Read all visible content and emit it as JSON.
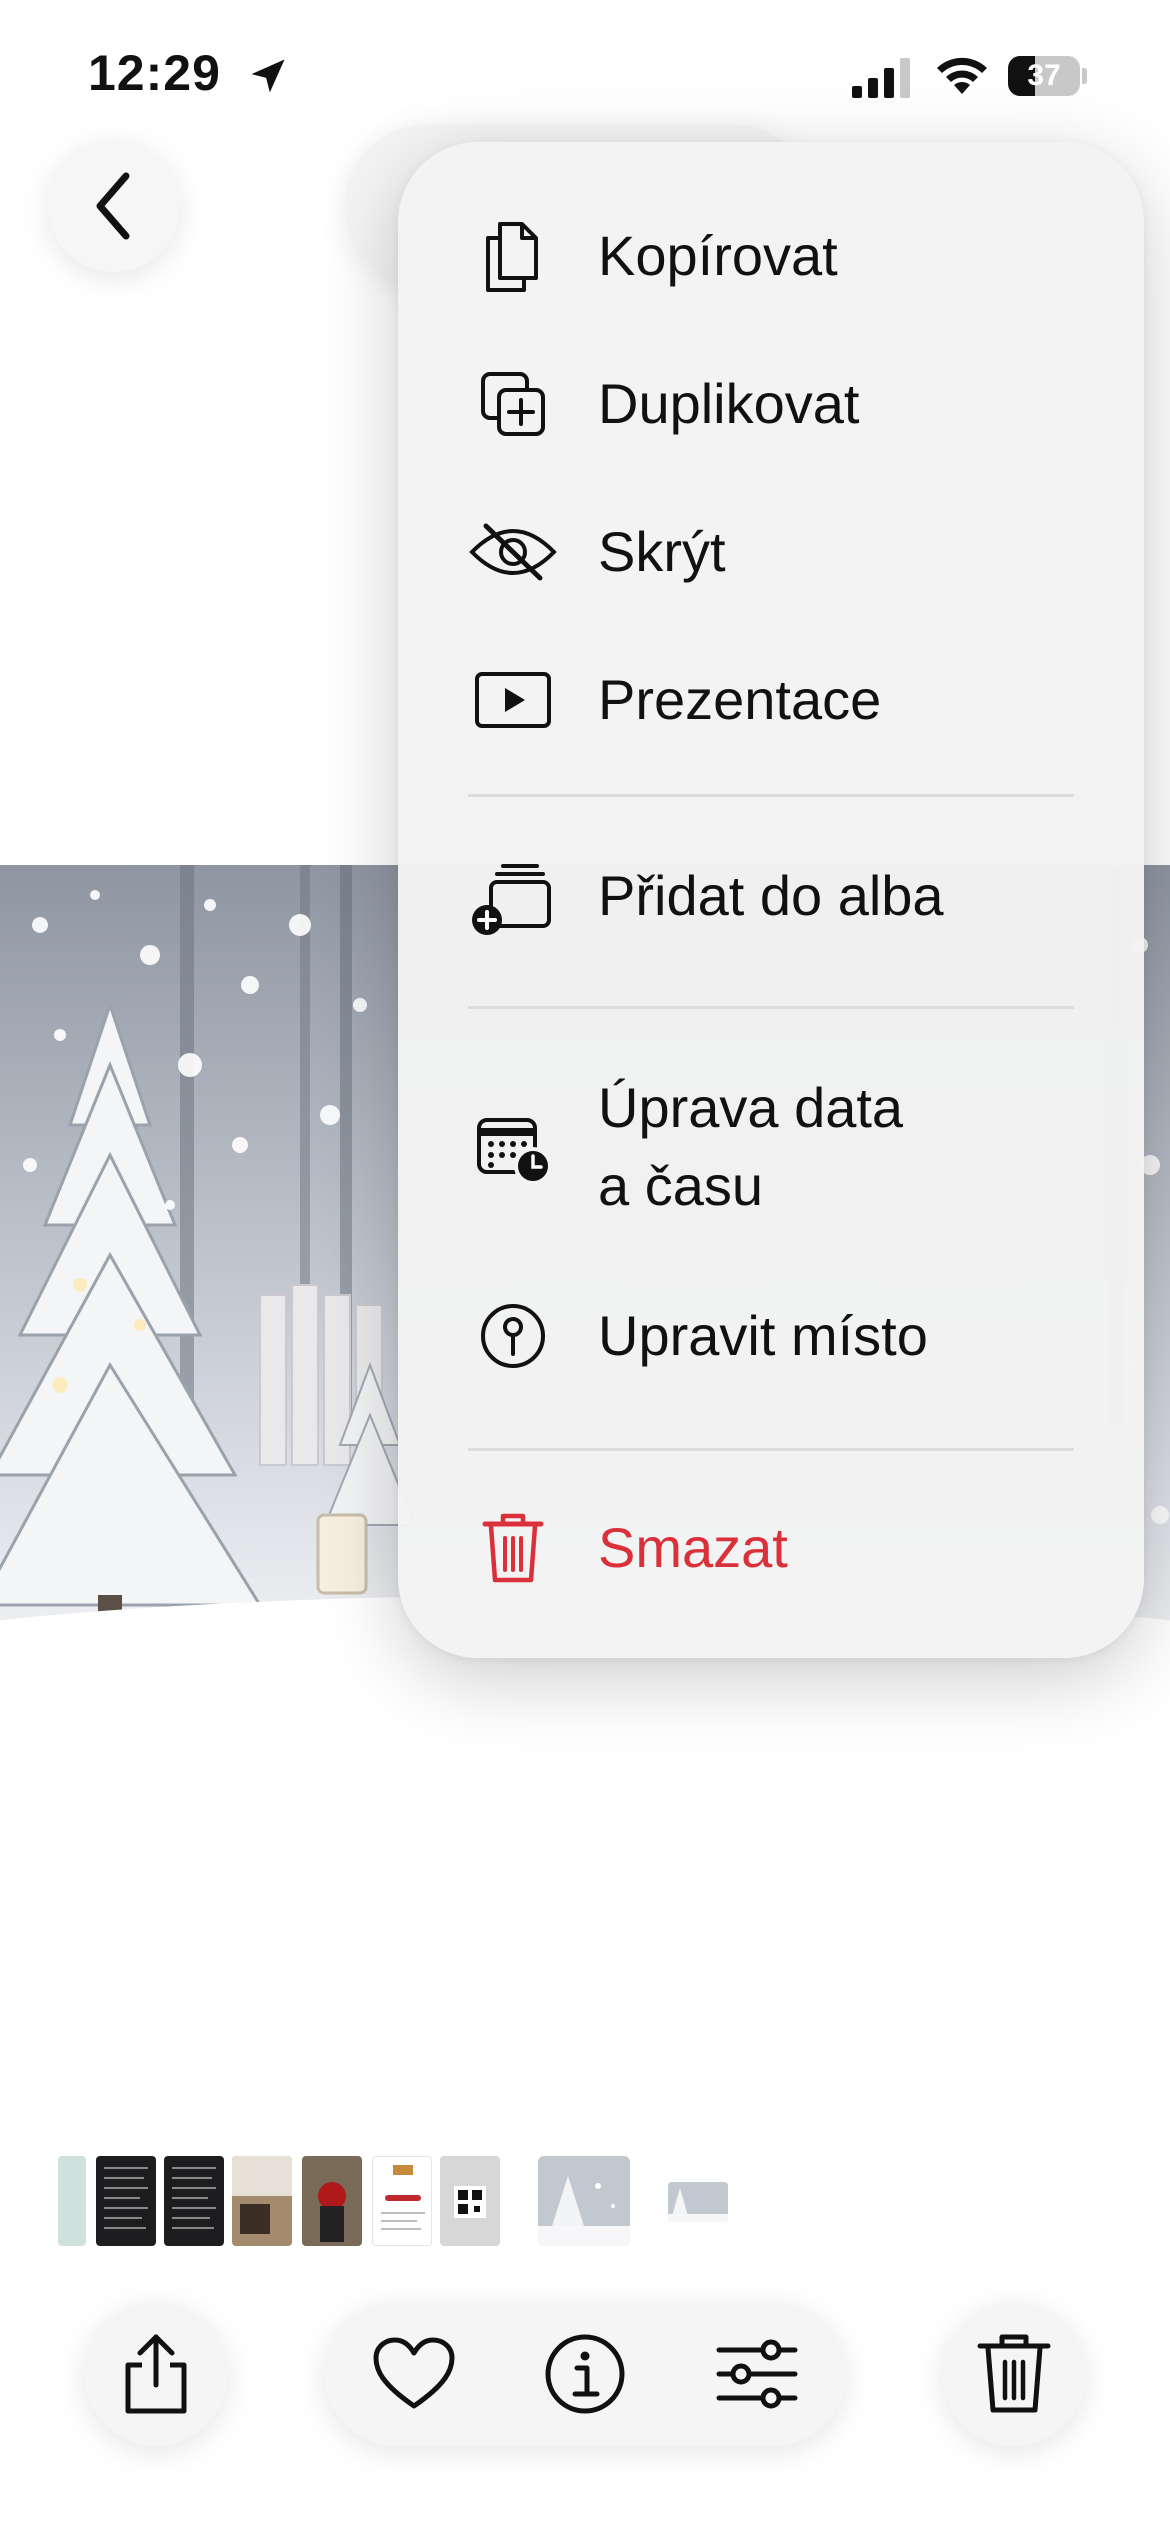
{
  "status_bar": {
    "time": "12:29",
    "battery_level": "37",
    "battery_fraction": 0.37,
    "icons": [
      "location-arrow-icon",
      "cellular-signal-icon",
      "wifi-icon",
      "battery-icon"
    ]
  },
  "header": {
    "back_icon": "chevron-left-icon"
  },
  "context_menu": {
    "items": [
      {
        "label": "Kopírovat",
        "icon": "copy-icon"
      },
      {
        "label": "Duplikovat",
        "icon": "duplicate-icon"
      },
      {
        "label": "Skrýt",
        "icon": "eye-slash-icon"
      },
      {
        "label": "Prezentace",
        "icon": "slideshow-play-icon"
      },
      {
        "label": "Přidat do alba",
        "icon": "add-to-album-icon"
      },
      {
        "label": "Úprava data\na času",
        "icon": "calendar-clock-icon"
      },
      {
        "label": "Upravit místo",
        "icon": "location-pin-icon"
      },
      {
        "label": "Smazat",
        "icon": "trash-icon",
        "color": "#d9303a"
      }
    ]
  },
  "toolbar": {
    "share_icon": "share-icon",
    "favorite_icon": "heart-icon",
    "info_icon": "info-icon",
    "adjust_icon": "adjust-sliders-icon",
    "delete_icon": "trash-icon"
  },
  "colors": {
    "accent_danger": "#d9303a",
    "menu_background": "#f3f3f3",
    "text": "#111111"
  }
}
